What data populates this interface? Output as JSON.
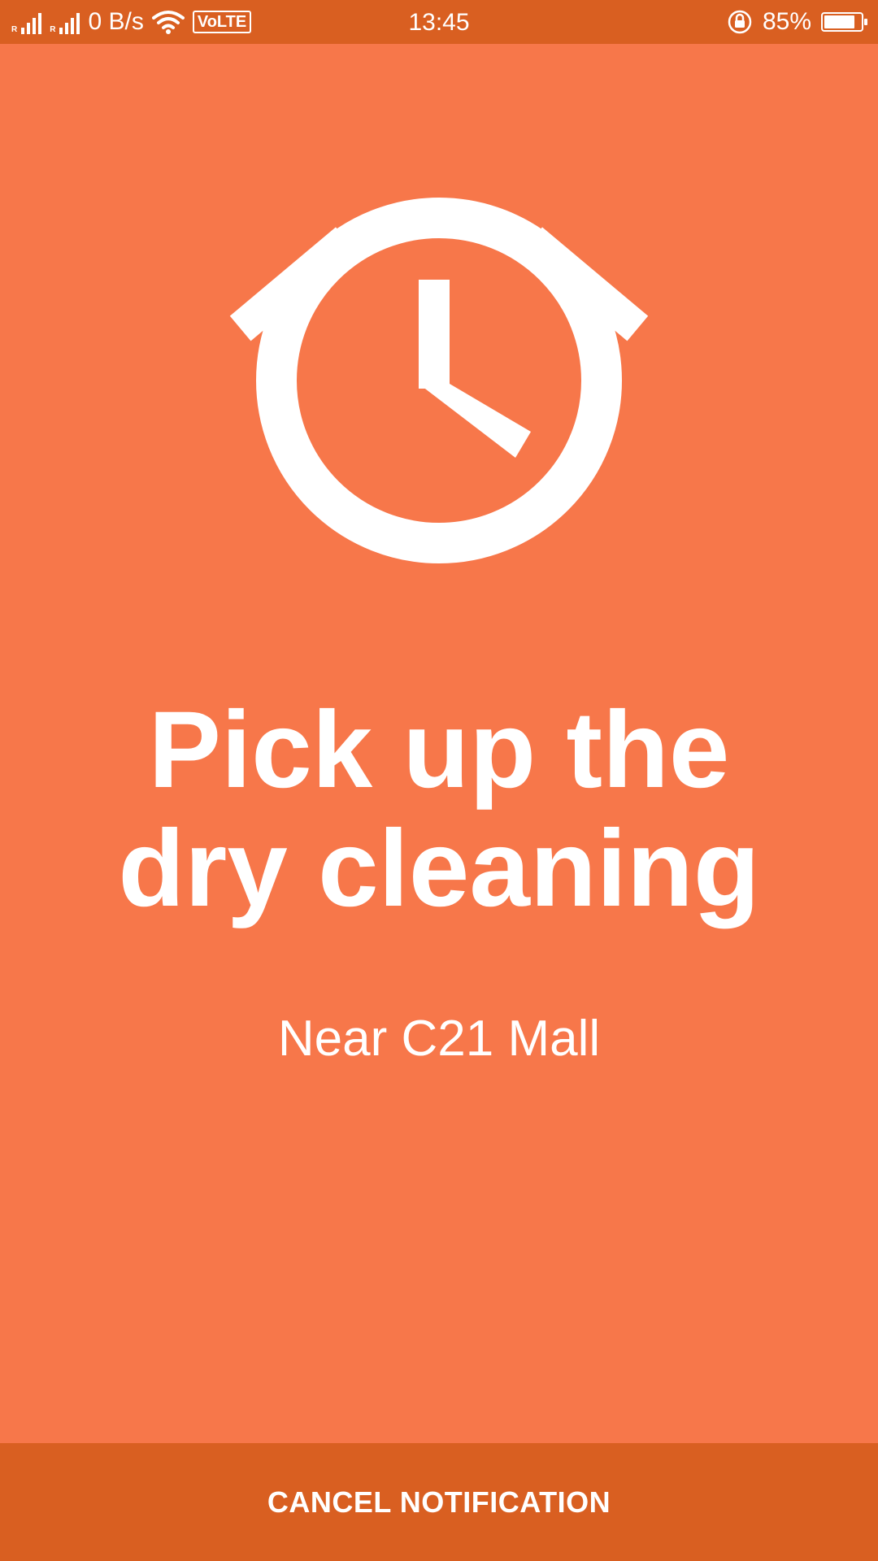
{
  "status_bar": {
    "net_speed": "0 B/s",
    "volte": "VoLTE",
    "time": "13:45",
    "battery_percent": "85%",
    "battery_level": 0.85,
    "sim1_label": "R",
    "sim2_label": "R"
  },
  "alarm": {
    "title": "Pick up the dry cleaning",
    "location": "Near C21 Mall",
    "icon": "alarm-clock-icon"
  },
  "actions": {
    "cancel_label": "CANCEL NOTIFICATION"
  },
  "colors": {
    "background": "#f7774a",
    "status_bar": "#d95f21",
    "action_bar": "#d95f21",
    "foreground": "#ffffff"
  }
}
